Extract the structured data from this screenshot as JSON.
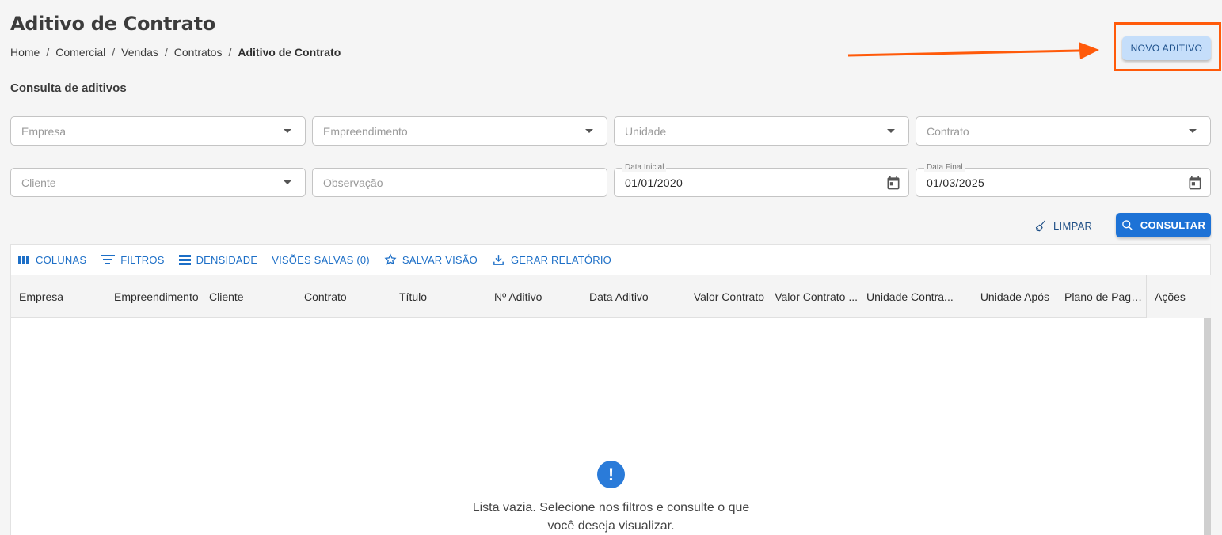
{
  "page": {
    "title": "Aditivo de Contrato",
    "breadcrumb": [
      "Home",
      "Comercial",
      "Vendas",
      "Contratos",
      "Aditivo de Contrato"
    ],
    "new_button": "NOVO ADITIVO",
    "section_title": "Consulta de aditivos",
    "highlight_color": "#ff5a0a"
  },
  "filters": {
    "empresa": {
      "placeholder": "Empresa"
    },
    "empreendimento": {
      "placeholder": "Empreendimento"
    },
    "unidade": {
      "placeholder": "Unidade"
    },
    "contrato": {
      "placeholder": "Contrato"
    },
    "cliente": {
      "placeholder": "Cliente"
    },
    "observacao": {
      "placeholder": "Observação"
    },
    "data_inicial": {
      "label": "Data Inicial",
      "value": "01/01/2020"
    },
    "data_final": {
      "label": "Data Final",
      "value": "01/03/2025"
    }
  },
  "actions": {
    "limpar": "LIMPAR",
    "consultar": "CONSULTAR"
  },
  "toolbar": {
    "colunas": "COLUNAS",
    "filtros": "FILTROS",
    "densidade": "DENSIDADE",
    "visoes_salvas": "VISÕES SALVAS (0)",
    "salvar_visao": "SALVAR VISÃO",
    "gerar_relatorio": "GERAR RELATÓRIO"
  },
  "columns": [
    "Empresa",
    "Empreendimento",
    "Cliente",
    "Contrato",
    "Título",
    "Nº Aditivo",
    "Data Aditivo",
    "Valor Contrato",
    "Valor Contrato ...",
    "Unidade Contra...",
    "Unidade Após",
    "Plano de Paga..."
  ],
  "actions_column": "Ações",
  "empty": {
    "line1": "Lista vazia. Selecione nos filtros e consulte o que",
    "line2": "você deseja visualizar."
  },
  "colors": {
    "primary": "#1d72d6",
    "link": "#1d6fc7",
    "new_button_bg": "#c5defa"
  }
}
